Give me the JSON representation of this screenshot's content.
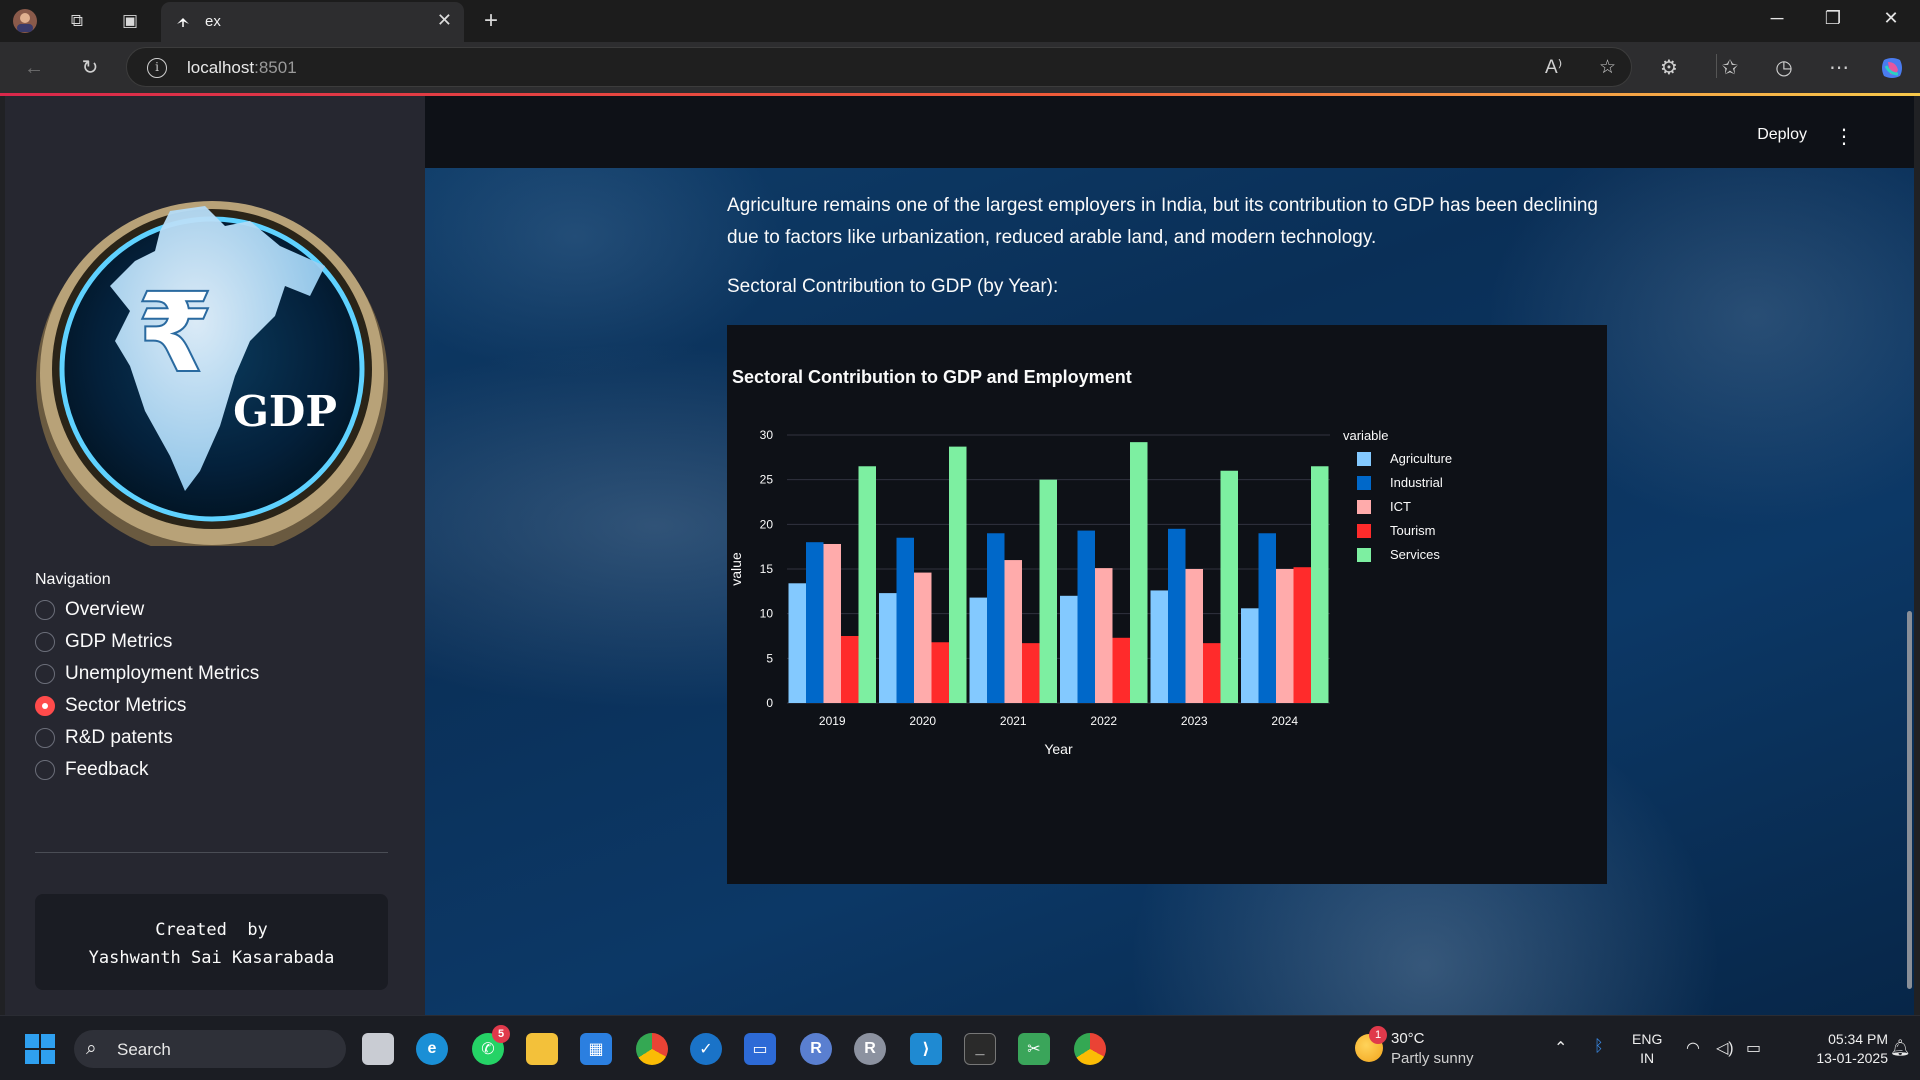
{
  "browser": {
    "tab_title": "ex",
    "url_host": "localhost",
    "url_port": ":8501"
  },
  "app": {
    "header": {
      "deploy_label": "Deploy"
    },
    "main": {
      "paragraph": "Agriculture remains one of the largest employers in India, but its contribution to GDP has been declining due to factors like urbanization, reduced arable land, and modern technology.",
      "subheading": "Sectoral Contribution to GDP (by Year):"
    },
    "sidebar": {
      "logo_text": "GDP",
      "logo_symbol": "₹",
      "nav_title": "Navigation",
      "nav_items": [
        {
          "label": "Overview",
          "selected": false
        },
        {
          "label": "GDP Metrics",
          "selected": false
        },
        {
          "label": "Unemployment Metrics",
          "selected": false
        },
        {
          "label": "Sector Metrics",
          "selected": true
        },
        {
          "label": "R&D patents",
          "selected": false
        },
        {
          "label": "Feedback",
          "selected": false
        }
      ],
      "credit": "Created  by\nYashwanth Sai Kasarabada"
    }
  },
  "chart_data": {
    "type": "bar",
    "title": "Sectoral Contribution to GDP and Employment",
    "xlabel": "Year",
    "ylabel": "value",
    "legend_title": "variable",
    "legend_position": "right",
    "categories": [
      "2019",
      "2020",
      "2021",
      "2022",
      "2023",
      "2024"
    ],
    "ylim": [
      0,
      30
    ],
    "yticks": [
      0,
      5,
      10,
      15,
      20,
      25,
      30
    ],
    "grid": true,
    "series": [
      {
        "name": "Agriculture",
        "color": "#83c9ff",
        "values": [
          13.4,
          12.3,
          11.8,
          12.0,
          12.6,
          10.6
        ]
      },
      {
        "name": "Industrial",
        "color": "#0068c9",
        "values": [
          18.0,
          18.5,
          19.0,
          19.3,
          19.5,
          19.0
        ]
      },
      {
        "name": "ICT",
        "color": "#ffabab",
        "values": [
          17.8,
          14.6,
          16.0,
          15.1,
          15.0,
          15.0
        ]
      },
      {
        "name": "Tourism",
        "color": "#ff2b2b",
        "values": [
          7.5,
          6.8,
          6.7,
          7.3,
          6.7,
          15.2
        ]
      },
      {
        "name": "Services",
        "color": "#7defa1",
        "values": [
          26.5,
          28.7,
          25.0,
          29.2,
          26.0,
          26.5
        ]
      }
    ]
  },
  "taskbar": {
    "search_label": "Search",
    "whatsapp_badge": "5",
    "weather_badge": "1",
    "temperature": "30°C",
    "weather_desc": "Partly sunny",
    "lang_line1": "ENG",
    "lang_line2": "IN",
    "time": "05:34 PM",
    "date": "13-01-2025"
  }
}
